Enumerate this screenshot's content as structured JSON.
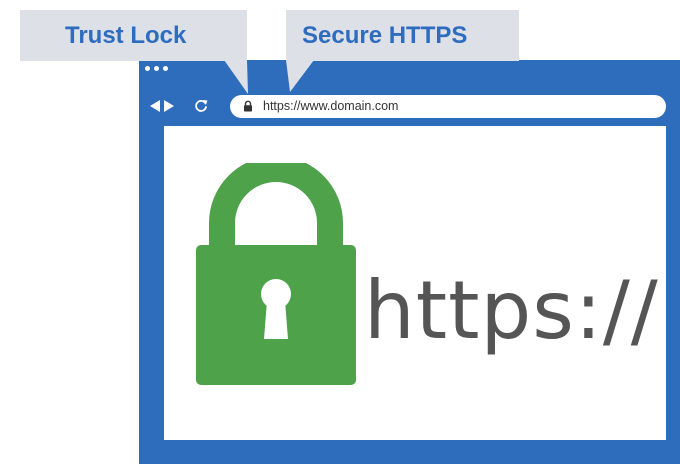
{
  "callouts": {
    "trust_lock": "Trust Lock",
    "secure_https": "Secure HTTPS"
  },
  "browser": {
    "address_bar": {
      "url": "https://www.domain.com"
    },
    "icons": [
      "window-dots",
      "back-forward-arrows",
      "reload",
      "lock"
    ]
  },
  "hero": {
    "protocol_text": "https://",
    "icon": "padlock"
  },
  "colors": {
    "frame_blue": "#2d6dbb",
    "callout_bg": "#dde0e7",
    "callout_text": "#2e6cc0",
    "lock_green": "#4da24a",
    "protocol_text": "#555555"
  }
}
